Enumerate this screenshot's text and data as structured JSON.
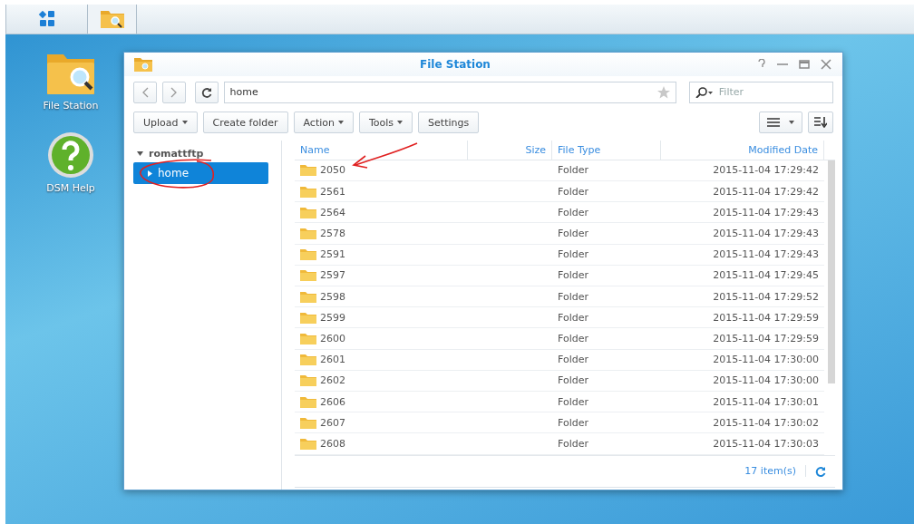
{
  "desktop": {
    "icons": [
      {
        "label": "File Station",
        "kind": "filestation"
      },
      {
        "label": "DSM Help",
        "kind": "help"
      }
    ]
  },
  "window": {
    "title": "File Station"
  },
  "toolbar": {
    "path": "home",
    "filter_placeholder": "Filter",
    "buttons": [
      {
        "label": "Upload",
        "dropdown": true
      },
      {
        "label": "Create folder",
        "dropdown": false
      },
      {
        "label": "Action",
        "dropdown": true
      },
      {
        "label": "Tools",
        "dropdown": true
      },
      {
        "label": "Settings",
        "dropdown": false
      }
    ]
  },
  "sidebar": {
    "items": [
      {
        "label": "romattftp",
        "expanded": true,
        "selected": false,
        "children": [
          {
            "label": "home",
            "expanded": false,
            "selected": true
          }
        ]
      }
    ]
  },
  "table": {
    "columns": [
      "Name",
      "Size",
      "File Type",
      "Modified Date"
    ],
    "rows": [
      {
        "name": "2050",
        "type": "Folder",
        "modified": "2015-11-04 17:29:42"
      },
      {
        "name": "2561",
        "type": "Folder",
        "modified": "2015-11-04 17:29:42"
      },
      {
        "name": "2564",
        "type": "Folder",
        "modified": "2015-11-04 17:29:43"
      },
      {
        "name": "2578",
        "type": "Folder",
        "modified": "2015-11-04 17:29:43"
      },
      {
        "name": "2591",
        "type": "Folder",
        "modified": "2015-11-04 17:29:43"
      },
      {
        "name": "2597",
        "type": "Folder",
        "modified": "2015-11-04 17:29:45"
      },
      {
        "name": "2598",
        "type": "Folder",
        "modified": "2015-11-04 17:29:52"
      },
      {
        "name": "2599",
        "type": "Folder",
        "modified": "2015-11-04 17:29:59"
      },
      {
        "name": "2600",
        "type": "Folder",
        "modified": "2015-11-04 17:29:59"
      },
      {
        "name": "2601",
        "type": "Folder",
        "modified": "2015-11-04 17:30:00"
      },
      {
        "name": "2602",
        "type": "Folder",
        "modified": "2015-11-04 17:30:00"
      },
      {
        "name": "2606",
        "type": "Folder",
        "modified": "2015-11-04 17:30:01"
      },
      {
        "name": "2607",
        "type": "Folder",
        "modified": "2015-11-04 17:30:02"
      },
      {
        "name": "2608",
        "type": "Folder",
        "modified": "2015-11-04 17:30:03"
      }
    ]
  },
  "status_bar": {
    "count": "17 item(s)"
  }
}
